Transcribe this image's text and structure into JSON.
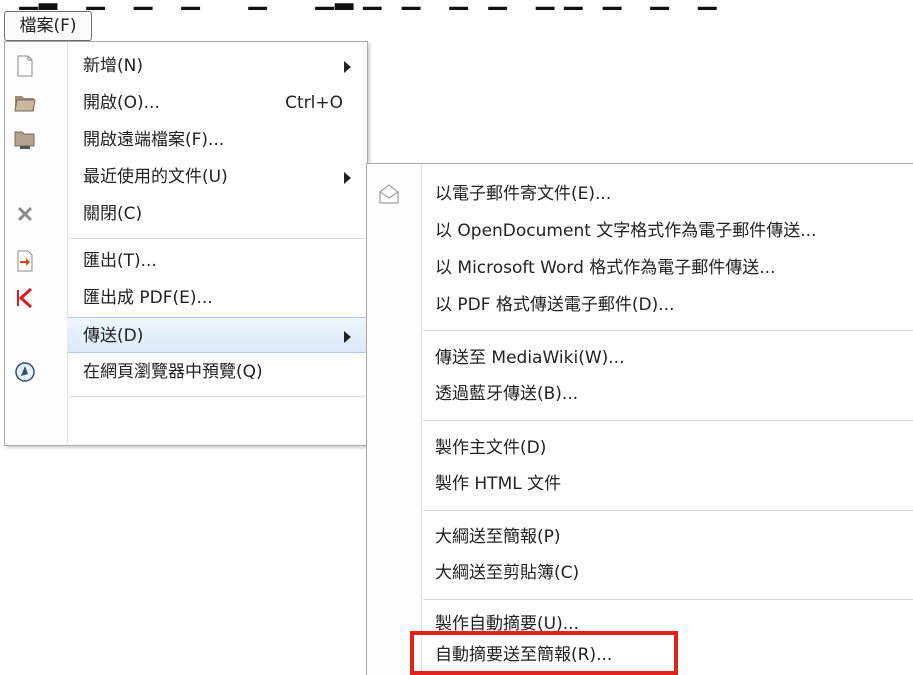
{
  "menubar": {
    "file_label": "檔案(F)"
  },
  "file_menu": {
    "items": [
      {
        "label": "新增(N)",
        "submenu": true,
        "icon": "new-document-icon"
      },
      {
        "label": "開啟(O)...",
        "shortcut": "Ctrl+O",
        "icon": "open-folder-icon"
      },
      {
        "label": "開啟遠端檔案(F)...",
        "icon": "remote-folder-icon"
      },
      {
        "label": "最近使用的文件(U)",
        "submenu": true
      },
      {
        "label": "關閉(C)",
        "icon": "close-icon"
      },
      {
        "label": "匯出(T)...",
        "icon": "export-icon"
      },
      {
        "label": "匯出成 PDF(E)...",
        "icon": "pdf-icon"
      },
      {
        "label": "傳送(D)",
        "submenu": true,
        "active": true
      },
      {
        "label": "在網頁瀏覽器中預覽(Q)",
        "icon": "web-preview-icon"
      }
    ]
  },
  "send_menu": {
    "items": [
      {
        "label": "以電子郵件寄文件(E)...",
        "icon": "email-icon"
      },
      {
        "label": "以 OpenDocument 文字格式作為電子郵件傳送..."
      },
      {
        "label": "以 Microsoft Word 格式作為電子郵件傳送..."
      },
      {
        "label": "以 PDF 格式傳送電子郵件(D)..."
      },
      {
        "label": "傳送至 MediaWiki(W)..."
      },
      {
        "label": "透過藍牙傳送(B)..."
      },
      {
        "label": "製作主文件(D)"
      },
      {
        "label": "製作 HTML 文件"
      },
      {
        "label": "大綱送至簡報(P)"
      },
      {
        "label": "大綱送至剪貼簿(C)"
      },
      {
        "label": "製作自動摘要(U)..."
      },
      {
        "label": "自動摘要送至簡報(R)...",
        "highlighted_box": true
      }
    ]
  },
  "colors": {
    "highlight_box": "#e0221b",
    "menu_hover": "#dbe9f8"
  }
}
